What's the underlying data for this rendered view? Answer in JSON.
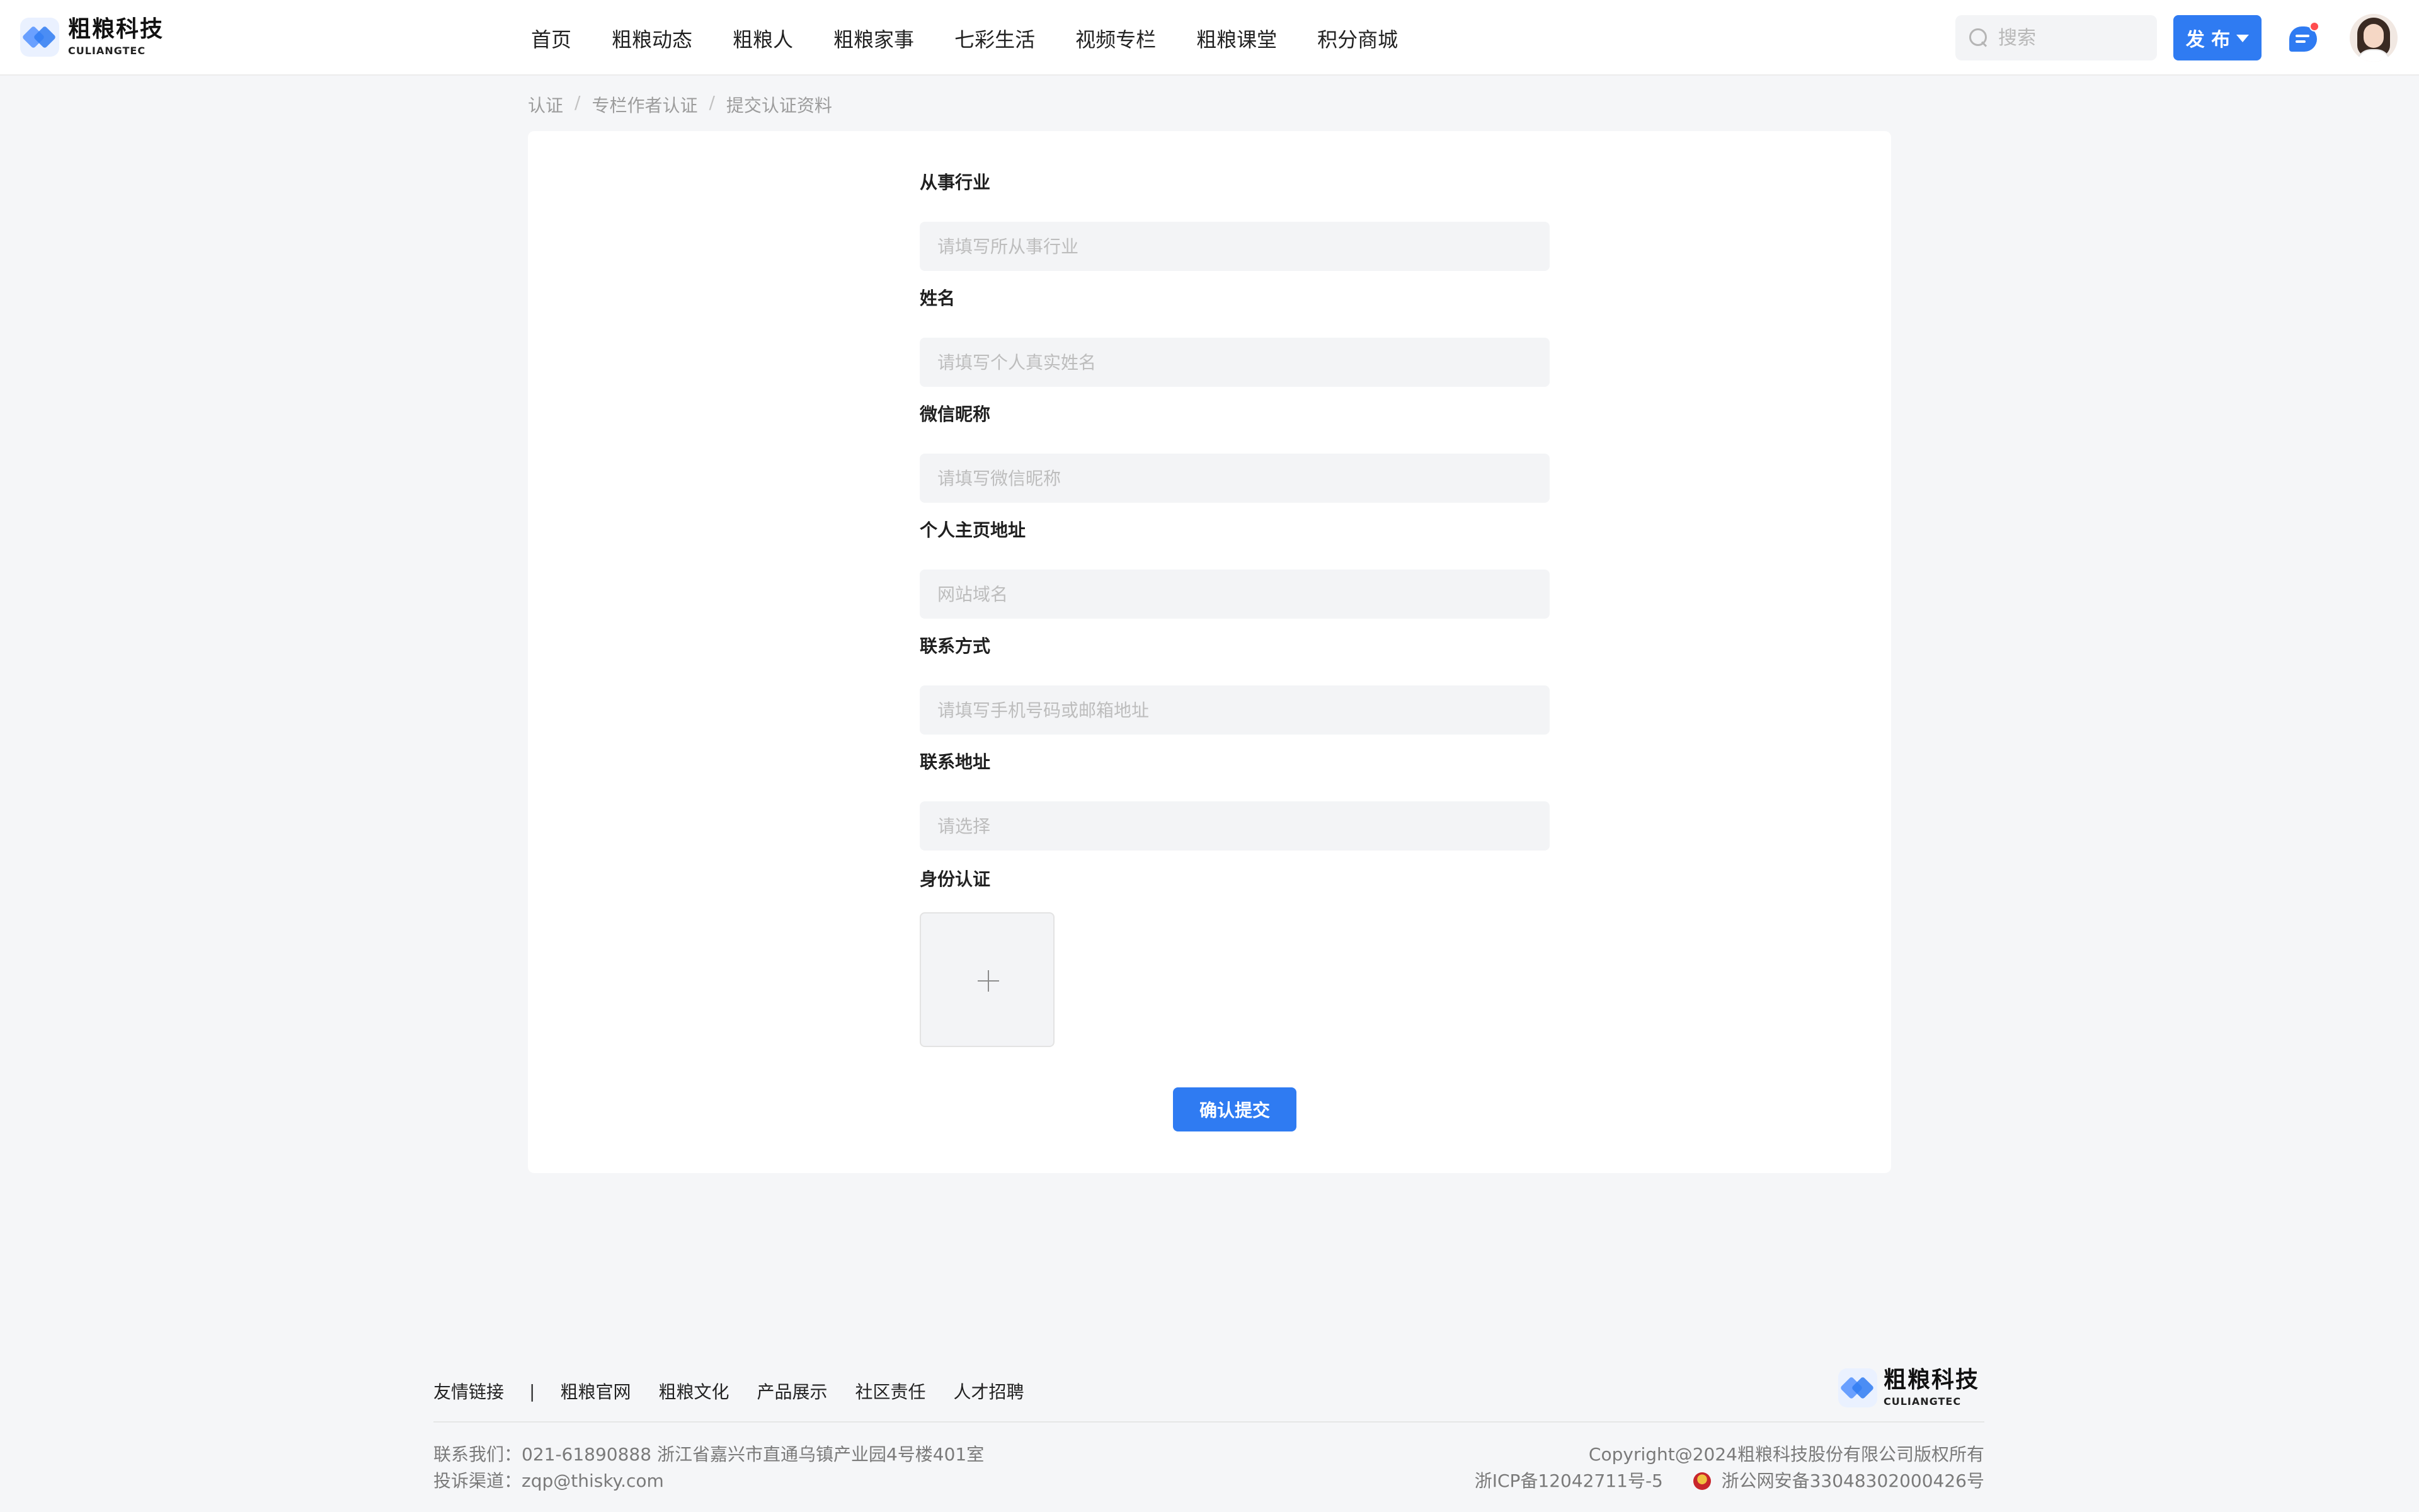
{
  "brand": {
    "name_cn": "粗粮科技",
    "name_en": "CULIANGTEC"
  },
  "nav": {
    "items": [
      {
        "label": "首页"
      },
      {
        "label": "粗粮动态"
      },
      {
        "label": "粗粮人"
      },
      {
        "label": "粗粮家事"
      },
      {
        "label": "七彩生活"
      },
      {
        "label": "视频专栏"
      },
      {
        "label": "粗粮课堂"
      },
      {
        "label": "积分商城"
      }
    ]
  },
  "header": {
    "search": {
      "placeholder": "搜索"
    },
    "publish_label": "发 布",
    "message_icon": "chat-bubble-icon",
    "avatar": "user-avatar"
  },
  "breadcrumb": [
    {
      "label": "认证"
    },
    {
      "label": "专栏作者认证"
    },
    {
      "label": "提交认证资料"
    }
  ],
  "form": {
    "fields": [
      {
        "label": "从事行业",
        "placeholder": "请填写所从事行业",
        "value": ""
      },
      {
        "label": "姓名",
        "placeholder": "请填写个人真实姓名",
        "value": ""
      },
      {
        "label": "微信昵称",
        "placeholder": "请填写微信昵称",
        "value": ""
      },
      {
        "label": "个人主页地址",
        "placeholder": "网站域名",
        "value": ""
      },
      {
        "label": "联系方式",
        "placeholder": "请填写手机号码或邮箱地址",
        "value": ""
      },
      {
        "label": "联系地址",
        "placeholder": "请选择",
        "value": ""
      }
    ],
    "upload_label": "身份认证",
    "submit_label": "确认提交"
  },
  "footer": {
    "links_title": "友情链接",
    "links_separator": "|",
    "links": [
      {
        "label": "粗粮官网"
      },
      {
        "label": "粗粮文化"
      },
      {
        "label": "产品展示"
      },
      {
        "label": "社区责任"
      },
      {
        "label": "人才招聘"
      }
    ],
    "contact": "联系我们：021-61890888   浙江省嘉兴市直通乌镇产业园4号楼401室",
    "complaint": "投诉渠道：zqp@thisky.com",
    "copyright": "Copyright@2024粗粮科技股份有限公司版权所有",
    "icp": "浙ICP备12042711号-5",
    "police": "浙公网安备33048302000426号"
  },
  "colors": {
    "accent": "#2f7bf2",
    "background": "#f5f6f8"
  }
}
